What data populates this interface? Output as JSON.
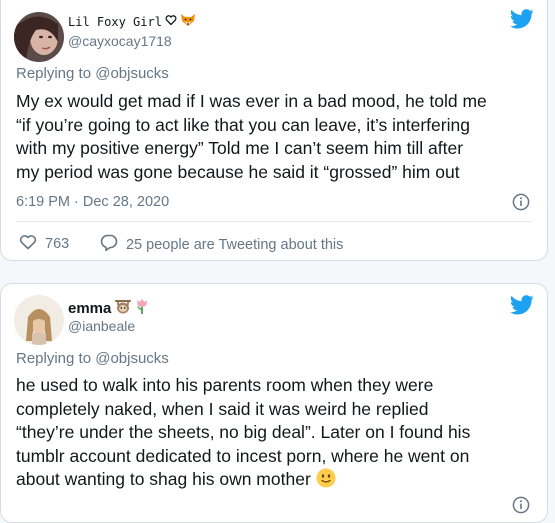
{
  "tweets": [
    {
      "display_name": "Lil Foxy Girl",
      "name_emojis": [
        "heart-outline-icon",
        "fox-icon"
      ],
      "handle": "@cayxocay1718",
      "replying_to": "Replying to @objsucks",
      "lines": [
        "My ex would get mad if I was ever in a bad mood, he told me",
        "“if you’re going to act like that you can leave, it’s interfering",
        "with my positive energy”  Told me I can’t seem him till after",
        "my period was gone because he said it “grossed” him out"
      ],
      "timestamp": "6:19 PM · Dec 28, 2020",
      "likes": "763",
      "retweet_text": "25 people are Tweeting about this"
    },
    {
      "display_name": "emma",
      "name_emojis": [
        "sloth-icon",
        "tulip-icon"
      ],
      "handle": "@ianbeale",
      "replying_to": "Replying to @objsucks",
      "lines": [
        "he used to walk into his parents room when they were",
        "completely naked, when I said it was weird he replied",
        "“they’re under the sheets, no big deal”. Later on I found his",
        "tumblr account dedicated to incest porn, where he went on",
        "about wanting to shag his own mother"
      ],
      "trailing_emoji": "slightly-smiling-face-icon"
    }
  ],
  "colors": {
    "twitter_blue": "#1da1f2",
    "text": "#14171a",
    "muted": "#657786",
    "border": "#d6dde2",
    "background": "#f5f8fa"
  }
}
